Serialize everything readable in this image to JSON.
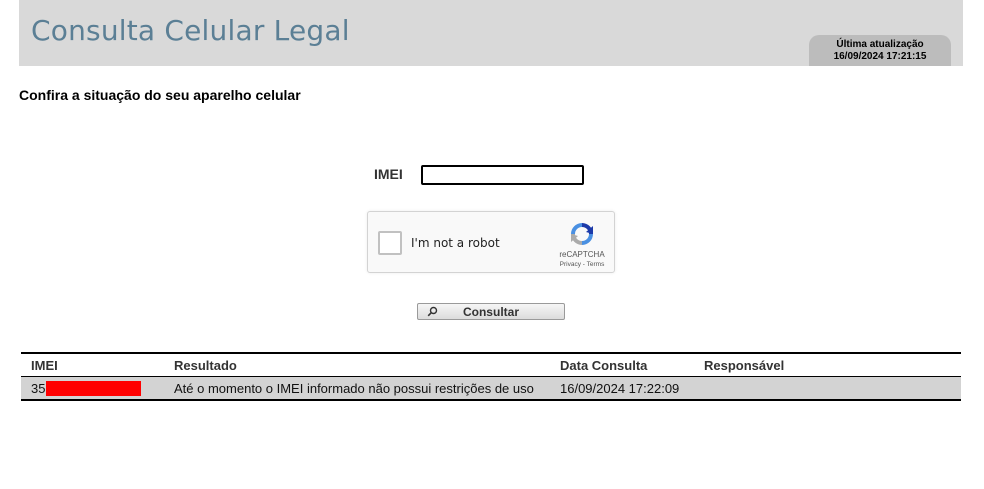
{
  "header": {
    "site_title": "Consulta Celular Legal",
    "update_label": "Última atualização",
    "update_datetime": "16/09/2024 17:21:15",
    "background_color": "#d9d9d9",
    "title_color": "#5b7f95"
  },
  "page": {
    "heading": "Confira a situação do seu aparelho celular"
  },
  "form": {
    "imei_label": "IMEI",
    "imei_value": "",
    "captcha": {
      "checkbox_label": "I'm not a robot",
      "brand": "reCAPTCHA",
      "privacy_link": "Privacy",
      "separator": "-",
      "terms_link": "Terms",
      "icon": "recaptcha-logo"
    },
    "submit_label": "Consultar",
    "submit_icon": "search-icon"
  },
  "results": {
    "columns": [
      "IMEI",
      "Resultado",
      "Data Consulta",
      "Responsável"
    ],
    "rows": [
      {
        "imei_prefix": "35",
        "imei_redacted": true,
        "resultado": "Até o momento o IMEI informado não possui restrições de uso",
        "data_consulta": "16/09/2024 17:22:09",
        "responsavel": ""
      }
    ],
    "row_color": "#d3d3d3",
    "redaction_color": "#ff0000"
  }
}
